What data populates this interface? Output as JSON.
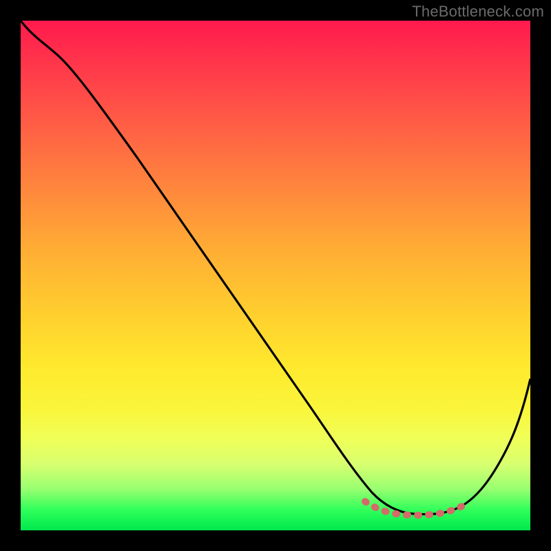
{
  "watermark": "TheBottleneck.com",
  "chart_data": {
    "type": "line",
    "title": "",
    "xlabel": "",
    "ylabel": "",
    "xlim": [
      0,
      100
    ],
    "ylim": [
      0,
      100
    ],
    "grid": false,
    "legend": false,
    "series": [
      {
        "name": "bottleneck-curve",
        "x": [
          0,
          3,
          8,
          14,
          20,
          30,
          40,
          50,
          60,
          66,
          70,
          74,
          78,
          82,
          86,
          90,
          94,
          100
        ],
        "y": [
          100,
          98,
          95,
          90,
          84,
          72,
          59,
          46,
          33,
          20,
          12,
          6,
          3.5,
          3.5,
          5,
          10,
          20,
          40
        ]
      },
      {
        "name": "optimal-zone",
        "x": [
          70,
          73,
          76,
          80,
          84,
          87,
          90
        ],
        "y": [
          6.5,
          4.5,
          3.8,
          3.5,
          3.8,
          4.5,
          6.5
        ]
      }
    ],
    "annotations": []
  },
  "colors": {
    "background": "#000000",
    "curve": "#000000",
    "optimal": "#d46a6a"
  }
}
